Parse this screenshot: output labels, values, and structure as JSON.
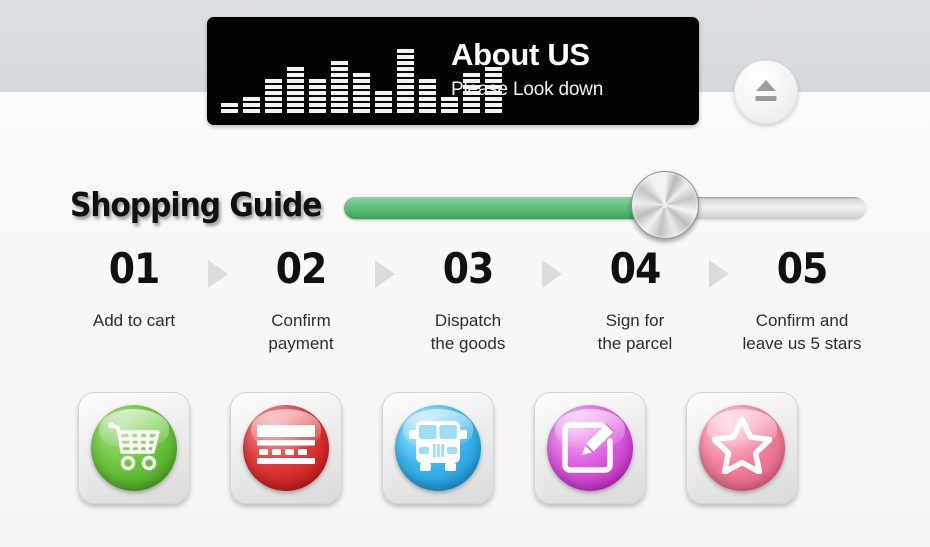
{
  "background": {
    "top_band_color": "#d8dcde",
    "bottom_band_color": "#f9f7f6"
  },
  "header": {
    "title": "About US",
    "subtitle": "Please Look down",
    "bar_color": "#030303",
    "equalizer": {
      "name": "equalizer-graphic",
      "segments": [
        2,
        3,
        6,
        8,
        6,
        9,
        7,
        4,
        11,
        6,
        3,
        7,
        8
      ]
    },
    "eject_button_label": ""
  },
  "guide": {
    "title": "Shopping Guide",
    "slider": {
      "progress_percent": 59,
      "filled_color": "#4fb26e",
      "track_color": "#e8e8e8"
    }
  },
  "steps": [
    {
      "number": "01",
      "label": "Add to cart",
      "icon": "shopping-cart-icon",
      "color": "#6cc73f"
    },
    {
      "number": "02",
      "label": "Confirm\npayment",
      "icon": "credit-card-icon",
      "color": "#e03a3a"
    },
    {
      "number": "03",
      "label": "Dispatch\nthe goods",
      "icon": "delivery-truck-icon",
      "color": "#3fb8ef"
    },
    {
      "number": "04",
      "label": "Sign for\nthe parcel",
      "icon": "sign-pencil-icon",
      "color": "#dd5fe0"
    },
    {
      "number": "05",
      "label": "Confirm and\nleave us 5 stars",
      "icon": "star-icon",
      "color": "#f2829e"
    }
  ],
  "step_labels_line1": [
    "Add to cart",
    "Confirm",
    "Dispatch",
    "Sign for",
    "Confirm and"
  ],
  "step_labels_line2": [
    "",
    "payment",
    "the goods",
    "the parcel",
    "leave us 5 stars"
  ],
  "arrow_separator": "triangle-right"
}
